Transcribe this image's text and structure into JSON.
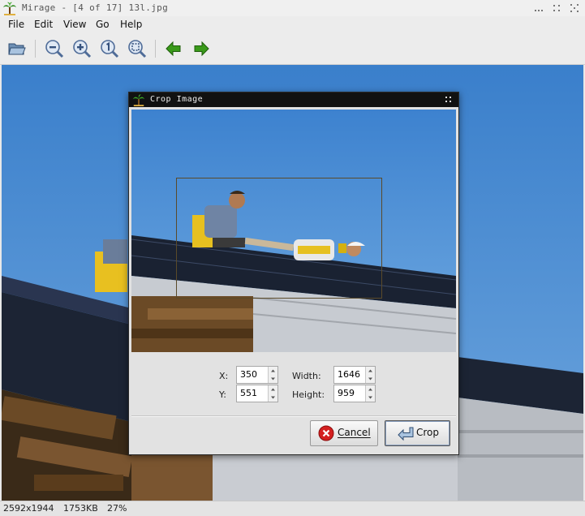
{
  "window": {
    "title": "Mirage - [4 of 17] 13l.jpg"
  },
  "menu": {
    "items": [
      "File",
      "Edit",
      "View",
      "Go",
      "Help"
    ]
  },
  "toolbar": {
    "buttons": [
      "open-folder-icon",
      "zoom-out-icon",
      "zoom-in-icon",
      "zoom-1to1-icon",
      "zoom-fit-icon",
      "previous-arrow-icon",
      "next-arrow-icon"
    ]
  },
  "status": {
    "dimensions": "2592x1944",
    "filesize": "1753KB",
    "zoom": "27%"
  },
  "dialog": {
    "title": "Crop Image",
    "x_label": "X:",
    "x_value": "350",
    "y_label": "Y:",
    "y_value": "551",
    "width_label": "Width:",
    "width_value": "1646",
    "height_label": "Height:",
    "height_value": "959",
    "cancel_label": "Cancel",
    "crop_label": "Crop"
  },
  "colors": {
    "sky": "#4f8ed4",
    "cancel_icon": "#d42020",
    "nav_arrow": "#3a9a1a"
  }
}
